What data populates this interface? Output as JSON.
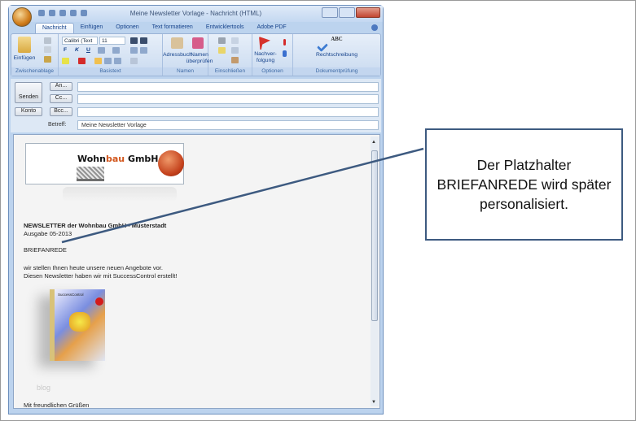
{
  "window": {
    "title": "Meine Newsletter Vorlage - Nachricht (HTML)"
  },
  "ribbon": {
    "tabs": [
      "Nachricht",
      "Einfügen",
      "Optionen",
      "Text formatieren",
      "Entwicklertools",
      "Adobe PDF"
    ],
    "active_tab": "Nachricht",
    "groups": {
      "clipboard": {
        "label": "Zwischenablage",
        "paste": "Einfügen"
      },
      "basic_text": {
        "label": "Basistext",
        "font": "Calibri (Text",
        "size": "11",
        "bold": "F",
        "italic": "K",
        "underline": "U"
      },
      "names": {
        "label": "Namen",
        "address_book": "Adressbuch",
        "check_names_1": "Namen",
        "check_names_2": "überprüfen"
      },
      "include": {
        "label": "Einschließen"
      },
      "options": {
        "label": "Optionen",
        "followup_1": "Nachver-",
        "followup_2": "folgung"
      },
      "proofing": {
        "label": "Dokumentprüfung",
        "spelling": "Rechtschreibung",
        "abc": "ABC"
      }
    }
  },
  "header": {
    "send": "Senden",
    "account": "Konto",
    "to": "An...",
    "cc": "Cc...",
    "bcc": "Bcc...",
    "subject_label": "Betreff:",
    "subject_value": "Meine Newsletter Vorlage",
    "to_value": "",
    "cc_value": "",
    "bcc_value": ""
  },
  "body": {
    "logo_text_a": "Wohn",
    "logo_text_b": "bau",
    "logo_text_c": " GmbH",
    "headline": "NEWSLETTER der Wohnbau GmbH - Musterstadt",
    "issue": "Ausgabe 05-2013",
    "salutation": "BRIEFANREDE",
    "line1": "wir stellen Ihnen heute unsere neuen Angebote vor.",
    "line2": "Diesen Newsletter haben wir mit SuccessControl erstellt!",
    "product_title": "SuccessControl",
    "blog": "blog",
    "closing": "Mit freundlichen Grüßen"
  },
  "annotation": {
    "text": "Der Platzhalter BRIEFANREDE wird später personalisiert.",
    "line_color": "#3d5a80"
  }
}
